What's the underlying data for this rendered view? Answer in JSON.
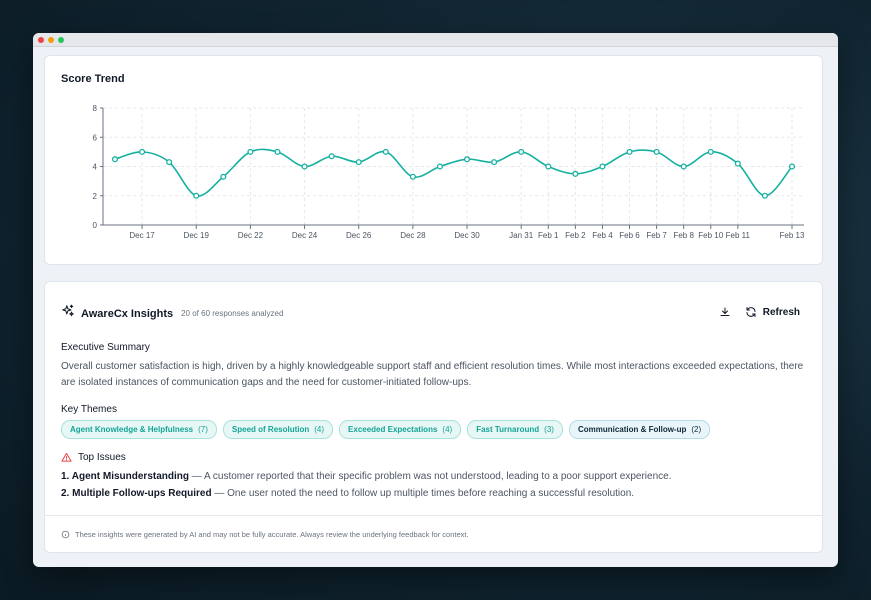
{
  "window": {
    "dots": [
      "#ef4444",
      "#f59e0b",
      "#22c55e"
    ]
  },
  "chart_card": {
    "title": "Score Trend"
  },
  "chart_data": {
    "type": "line",
    "title": "Score Trend",
    "color": "#14b0a0",
    "ylim": [
      0,
      8
    ],
    "yticks": [
      "0",
      "2",
      "4",
      "6",
      "8"
    ],
    "grid": true,
    "xlabels": [
      "Dec 17",
      "Dec 19",
      "Dec 22",
      "Dec 24",
      "Dec 26",
      "Dec 28",
      "Dec 30",
      "Jan 31",
      "Feb 1",
      "Feb 2",
      "Feb 4",
      "Feb 6",
      "Feb 7",
      "Feb 8",
      "Feb 10",
      "Feb 11",
      "Feb 13"
    ],
    "values": [
      4.5,
      5,
      4.3,
      2,
      3.3,
      5,
      5,
      4,
      4.7,
      4.3,
      5,
      3.3,
      4,
      4.5,
      4.3,
      5,
      4,
      3.5,
      4,
      5,
      5,
      4,
      5,
      4.2,
      2,
      4
    ]
  },
  "insights": {
    "title": "AwareCx Insights",
    "subtitle": "20 of 60 responses analyzed",
    "refresh_label": "Refresh",
    "summary_label": "Executive Summary",
    "summary_text": "Overall customer satisfaction is high, driven by a highly knowledgeable support staff and efficient resolution times. While most interactions exceeded expectations, there are isolated instances of communication gaps and the need for customer-initiated follow-ups.",
    "themes_label": "Key Themes",
    "themes": [
      {
        "label": "Agent Knowledge & Helpfulness",
        "count": "(7)"
      },
      {
        "label": "Speed of Resolution",
        "count": "(4)"
      },
      {
        "label": "Exceeded Expectations",
        "count": "(4)"
      },
      {
        "label": "Fast Turnaround",
        "count": "(3)"
      },
      {
        "label": "Communication & Follow-up",
        "count": "(2)"
      }
    ],
    "issues_label": "Top Issues",
    "issues": [
      {
        "num": "1.",
        "title": "Agent Misunderstanding",
        "text": " — A customer reported that their specific problem was not understood, leading to a poor support experience."
      },
      {
        "num": "2.",
        "title": "Multiple Follow-ups Required",
        "text": " — One user noted the need to follow up multiple times before reaching a successful resolution."
      }
    ],
    "footer": "These insights were generated by AI and may not be fully accurate. Always review the underlying feedback for context.",
    "colors": {
      "accent": "#14b0a0",
      "warning": "#ef4444"
    }
  }
}
